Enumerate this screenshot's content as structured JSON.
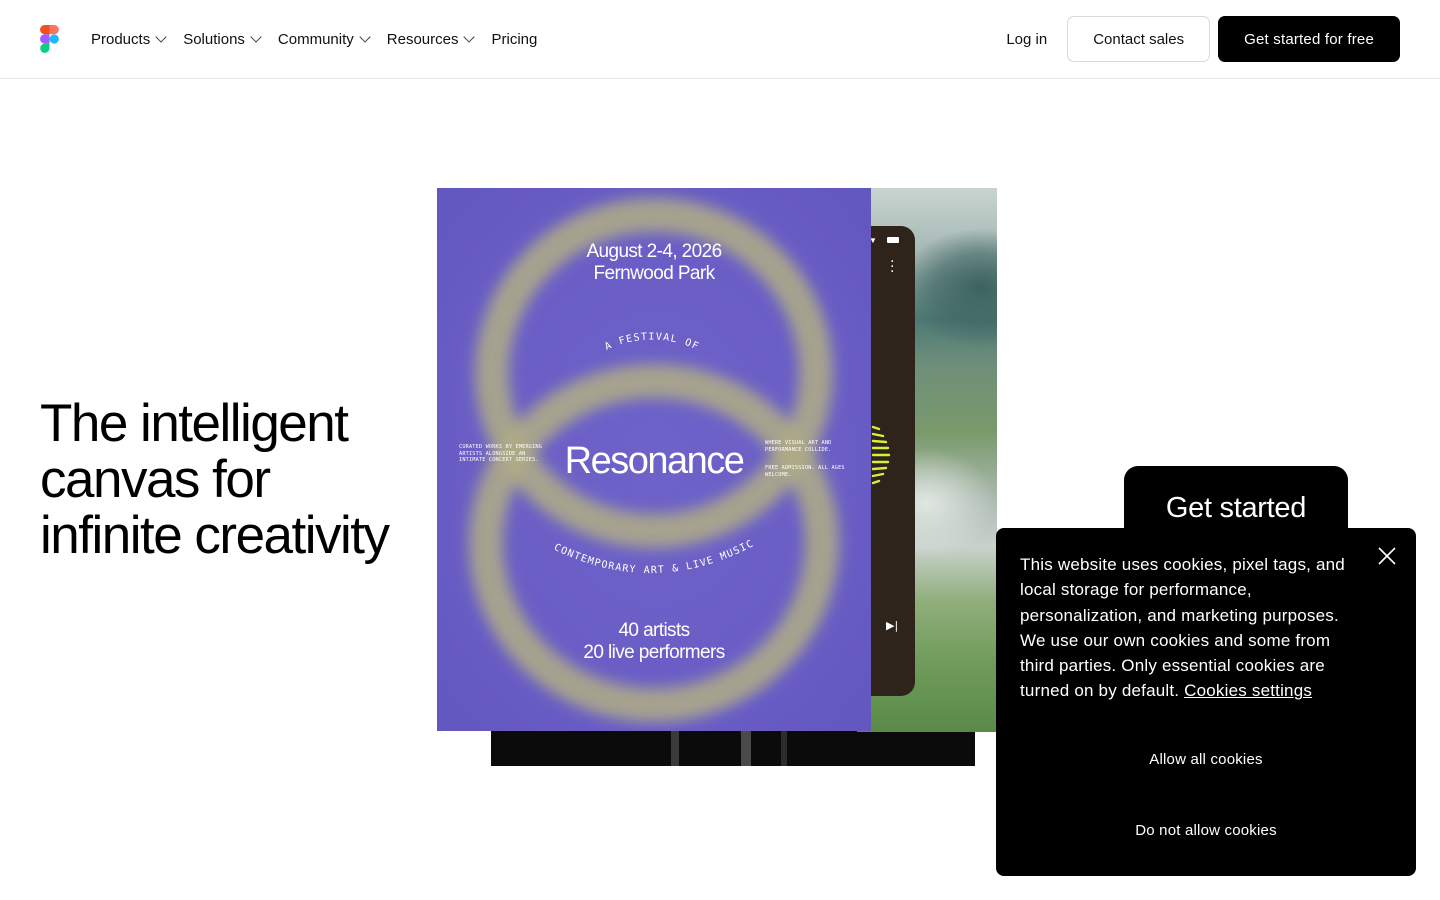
{
  "nav": {
    "logo_icon": "figma-logo-icon",
    "items": [
      {
        "label": "Products",
        "has_dropdown": true
      },
      {
        "label": "Solutions",
        "has_dropdown": true
      },
      {
        "label": "Community",
        "has_dropdown": true
      },
      {
        "label": "Resources",
        "has_dropdown": true
      },
      {
        "label": "Pricing",
        "has_dropdown": false
      }
    ],
    "login_label": "Log in",
    "contact_label": "Contact sales",
    "cta_label": "Get started for free"
  },
  "hero": {
    "title": "The intelligent canvas for infinite creativity"
  },
  "poster": {
    "date_line1": "August 2-4, 2026",
    "date_line2": "Fernwood Park",
    "arc_top": "A FESTIVAL OF",
    "name": "Resonance",
    "arc_bottom": "CONTEMPORARY ART & LIVE MUSIC",
    "count_line1": "40 artists",
    "count_line2": "20 live performers",
    "left_note": "CURATED WORKS BY EMERGING ARTISTS ALONGSIDE AN INTIMATE CONCERT SERIES.",
    "right_note1": "WHERE VISUAL ART AND PERFORMANCE COLLIDE.",
    "right_note2": "FREE ADMISSION. ALL AGES WELCOME."
  },
  "get_started_tab": {
    "label": "Get started"
  },
  "cookie": {
    "text": "This website uses cookies, pixel tags, and local storage for performance, personalization, and marketing purposes. We use our own cookies and some from third parties. Only essential cookies are turned on by default.",
    "settings_link": "Cookies settings",
    "allow_label": "Allow all cookies",
    "deny_label": "Do not allow cookies",
    "close_icon": "close-icon"
  },
  "colors": {
    "brand_black": "#000000",
    "poster_purple": "#6a5ec6",
    "ring_olive": "#a7a98a",
    "visualizer_lime": "#d4f03a"
  }
}
